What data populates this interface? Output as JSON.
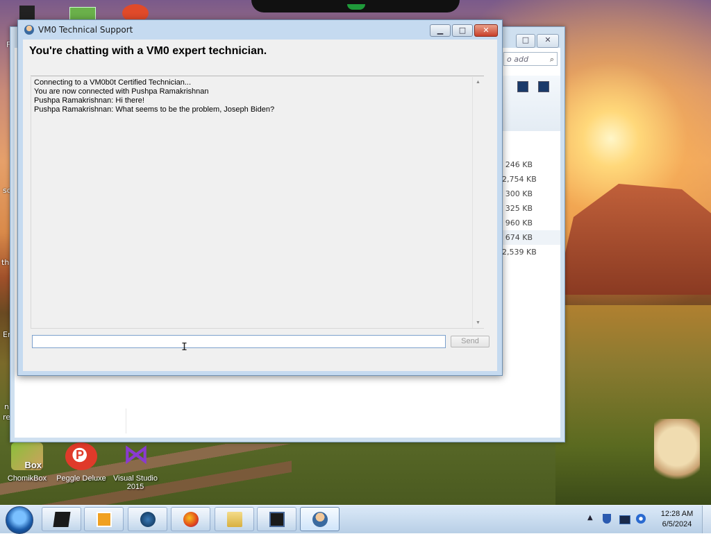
{
  "chat_window": {
    "title": "VM0 Technical Support",
    "heading": "You're chatting with a VM0 expert technician.",
    "messages": [
      "Connecting to a VM0b0t Certified Technician...",
      "You are now connected with Pushpa Ramakrishnan",
      "Pushpa Ramakrishnan: Hi there!",
      "Pushpa Ramakrishnan: What seems to be the problem, Joseph Biden?"
    ],
    "input_value": "",
    "send_label": "Send",
    "minimize_glyph": "▁",
    "maximize_glyph": "□",
    "close_glyph": "✕"
  },
  "background_window": {
    "search_placeholder": "o add",
    "search_icon": "⌕",
    "file_sizes": [
      "246 KB",
      "2,754 KB",
      "300 KB",
      "325 KB",
      "960 KB",
      "674 KB",
      "2,539 KB"
    ],
    "highlighted_index": 5
  },
  "desktop_icons": [
    {
      "label": "ChomikBox",
      "badge": "Box"
    },
    {
      "label": "Peggle Deluxe",
      "badge": "P"
    },
    {
      "label": "Visual Studio 2015",
      "badge": "⋈"
    }
  ],
  "desktop_edge_text": [
    "F",
    "sc",
    "th",
    "Er",
    "n",
    "re"
  ],
  "taskbar": {
    "clock_time": "12:28 AM",
    "clock_date": "6/5/2024",
    "tray_expand": "▲"
  },
  "colors": {
    "title_bar": "#c5daf0",
    "close_button": "#c8402a",
    "client_bg": "#f0f0f0"
  }
}
